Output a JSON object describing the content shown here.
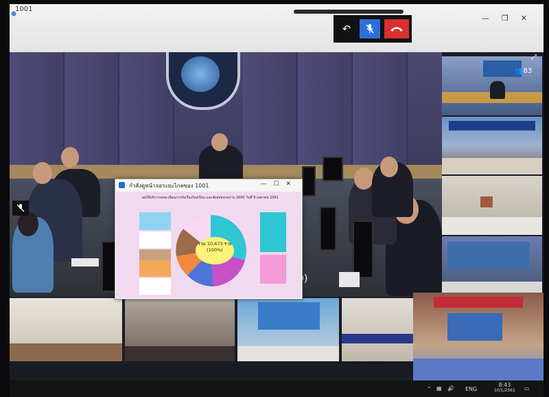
{
  "window": {
    "title": "1001",
    "controls": [
      "—",
      "❐",
      "✕"
    ]
  },
  "call_controls": {
    "back_icon": "↶",
    "mic_icon": "🎤",
    "end_icon": "✆"
  },
  "participants": {
    "count_icon": "👥",
    "count": "83"
  },
  "main_video": {
    "partial_label": "0)"
  },
  "shared_window": {
    "title": "กำลังดูหน้าจอระยะไกลของ 1001",
    "controls": [
      "—",
      "☐",
      "✕"
    ],
    "slide": {
      "heading": "ผลให้บริการลงทะเบียนการรับเรื่องร้องเรียน และจัดส่งหน่วยงาน 1600 วันที่ 9 เมษายน 2561",
      "total_line1": "รวม 10,673 ราย",
      "total_line2": "(100%)",
      "colors": {
        "pie_cyan": "#2ec7d3",
        "pie_orange": "#f08a3c",
        "pie_magenta": "#c94fc7",
        "pie_blue": "#4d74d6",
        "pie_brown": "#9b6b4a",
        "box_blue": "#8fd3f3",
        "box_orange": "#f3a85a",
        "box_pink": "#f49ad6"
      }
    }
  },
  "tray": {
    "language": "ENG",
    "time": "8:43",
    "date": "10/1/2561"
  }
}
